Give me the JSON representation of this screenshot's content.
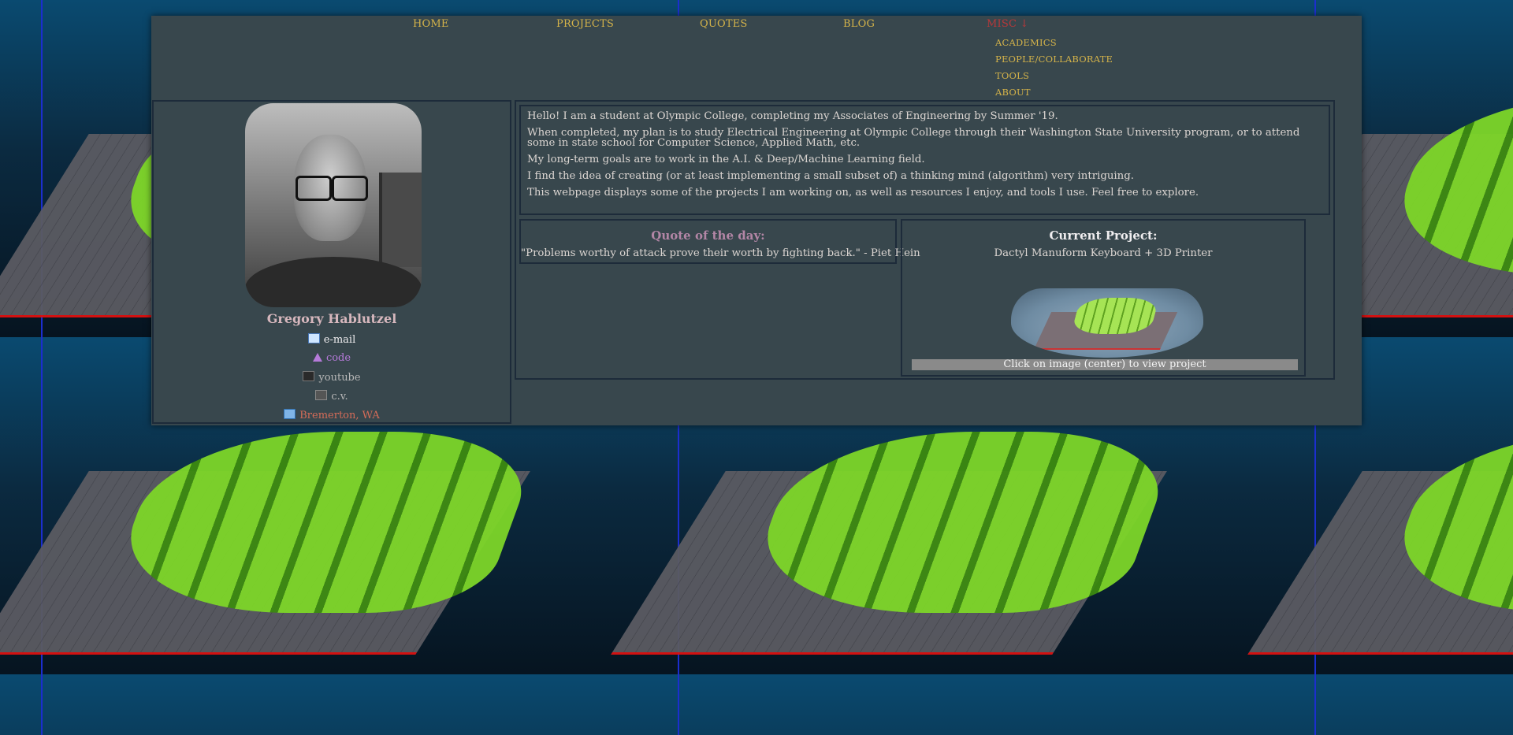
{
  "nav": {
    "items": [
      "HOME",
      "PROJECTS",
      "QUOTES",
      "BLOG"
    ],
    "misc_label": "MISC ↓",
    "submenu": [
      "ACADEMICS",
      "PEOPLE/COLLABORATE",
      "TOOLS",
      "ABOUT"
    ]
  },
  "profile": {
    "name": "Gregory Hablutzel",
    "links": {
      "email": "e-mail",
      "code": "code",
      "youtube": "youtube",
      "cv": "c.v.",
      "location": "Bremerton, WA"
    }
  },
  "intro": [
    "Hello! I am a student at Olympic College, completing my Associates of Engineering by Summer '19.",
    "When completed, my plan is to study Electrical Engineering at Olympic College through their Washington State University program, or to attend some in state school for Computer Science, Applied Math, etc.",
    "My long-term goals are to work in the A.I. & Deep/Machine Learning field.",
    "I find the idea of creating (or at least implementing a small subset of) a thinking mind (algorithm) very intriguing.",
    "This webpage displays some of the projects I am working on, as well as resources I enjoy, and tools I use. Feel free to explore."
  ],
  "quote": {
    "title": "Quote of the day:",
    "text": "\"Problems worthy of attack prove their worth by fighting back.\" - Piet Hein"
  },
  "project": {
    "title": "Current Project:",
    "name": "Dactyl Manuform Keyboard + 3D Printer",
    "view_label": "Click on image (center) to view project"
  },
  "colors": {
    "panel": "#38474d",
    "nav_link": "#d4b34a",
    "misc_link": "#b8383a",
    "name": "#d6b7bd",
    "quote_title": "#b386a6",
    "code_link": "#b57ad9",
    "location_link": "#d66c58"
  }
}
